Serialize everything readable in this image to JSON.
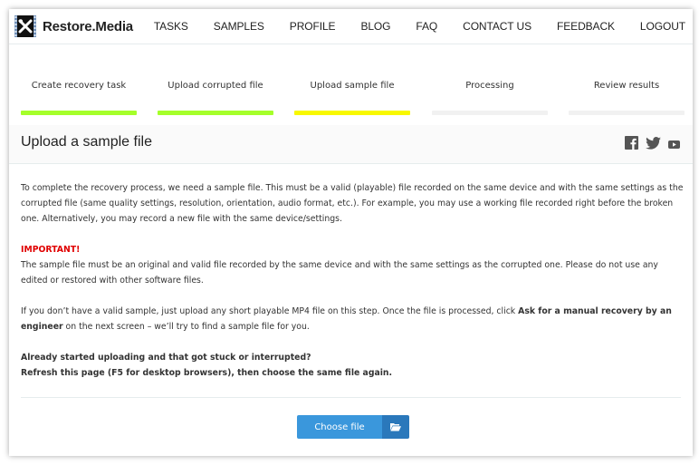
{
  "header": {
    "brand": "Restore.Media",
    "logo_icon": "film-tools-icon",
    "nav": [
      "TASKS",
      "SAMPLES",
      "PROFILE",
      "BLOG",
      "FAQ",
      "CONTACT US",
      "FEEDBACK",
      "LOGOUT"
    ]
  },
  "steps": [
    {
      "label": "Create recovery task",
      "status": "done",
      "color": "#a5ff2a"
    },
    {
      "label": "Upload corrupted file",
      "status": "done",
      "color": "#a5ff2a"
    },
    {
      "label": "Upload sample file",
      "status": "current",
      "color": "#f8f800"
    },
    {
      "label": "Processing",
      "status": "pending",
      "color": "#f1f1f1"
    },
    {
      "label": "Review results",
      "status": "pending",
      "color": "#f1f1f1"
    }
  ],
  "panel": {
    "title": "Upload a sample file",
    "social_icons": [
      "facebook-icon",
      "twitter-icon",
      "youtube-icon"
    ]
  },
  "content": {
    "intro": "To complete the recovery process, we need a sample file. This must be a valid (playable) file recorded on the same device and with the same settings as the corrupted file (same quality settings, resolution, orientation, audio format, etc.). For example, you may use a working file recorded right before the broken one. Alternatively, you may record a new file with the same device/settings.",
    "important_label": "IMPORTANT!",
    "important_text": "The sample file must be an original and valid file recorded by the same device and with the same settings as the corrupted one. Please do not use any edited or restored with other software files.",
    "no_sample_before": "If you don’t have a valid sample, just upload any short playable MP4 file on this step. Once the file is processed, click ",
    "no_sample_bold": "Ask for a manual recovery by an engineer",
    "no_sample_after": " on the next screen – we’ll try to find a sample file for you.",
    "stuck_line1": "Already started uploading and that got stuck or interrupted?",
    "stuck_line2": "Refresh this page (F5 for desktop browsers), then choose the same file again."
  },
  "upload": {
    "button_label": "Choose file",
    "button_icon": "folder-open-icon"
  }
}
